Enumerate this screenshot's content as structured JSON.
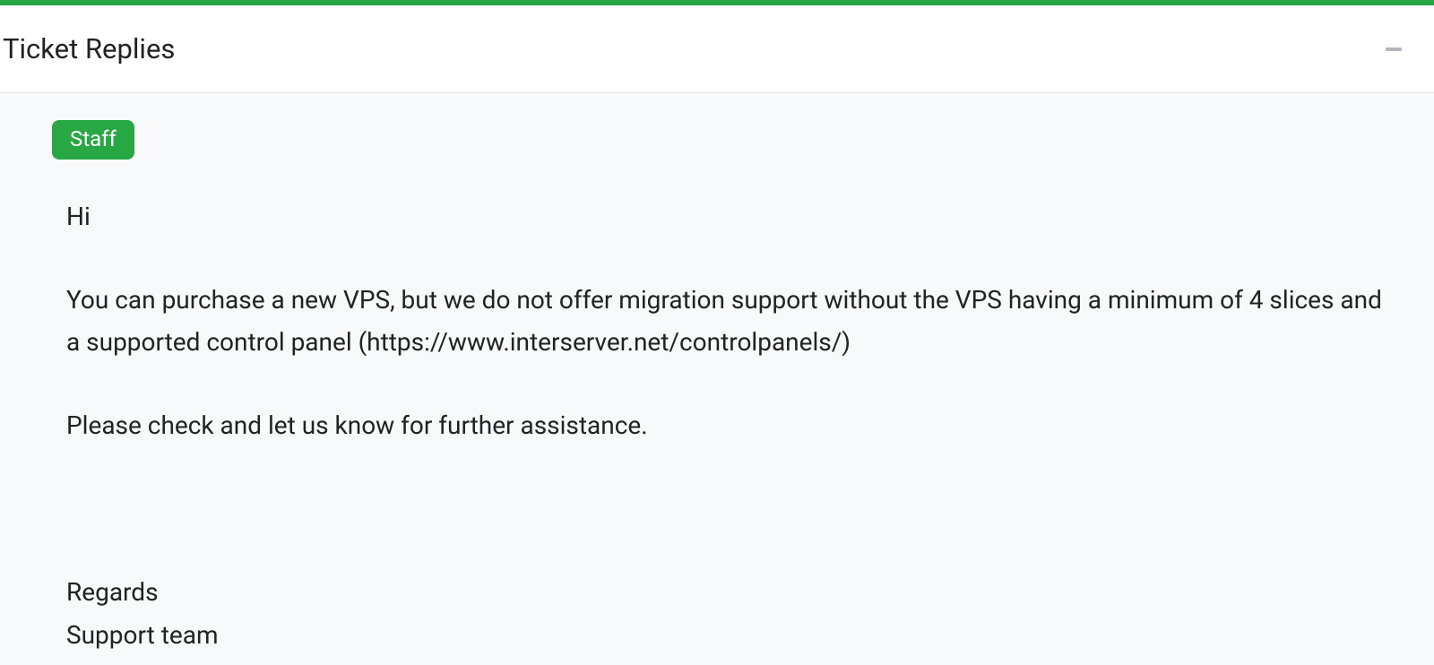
{
  "panel": {
    "title": "Ticket Replies"
  },
  "reply": {
    "badge": "Staff",
    "greeting": "Hi",
    "body": "You can purchase a new VPS, but we do not offer migration support without the VPS having a minimum of 4 slices and a supported control panel (https://www.interserver.net/controlpanels/)",
    "followup": "Please check and let us know for further assistance.",
    "signoff": "Regards",
    "team": "Support team"
  }
}
